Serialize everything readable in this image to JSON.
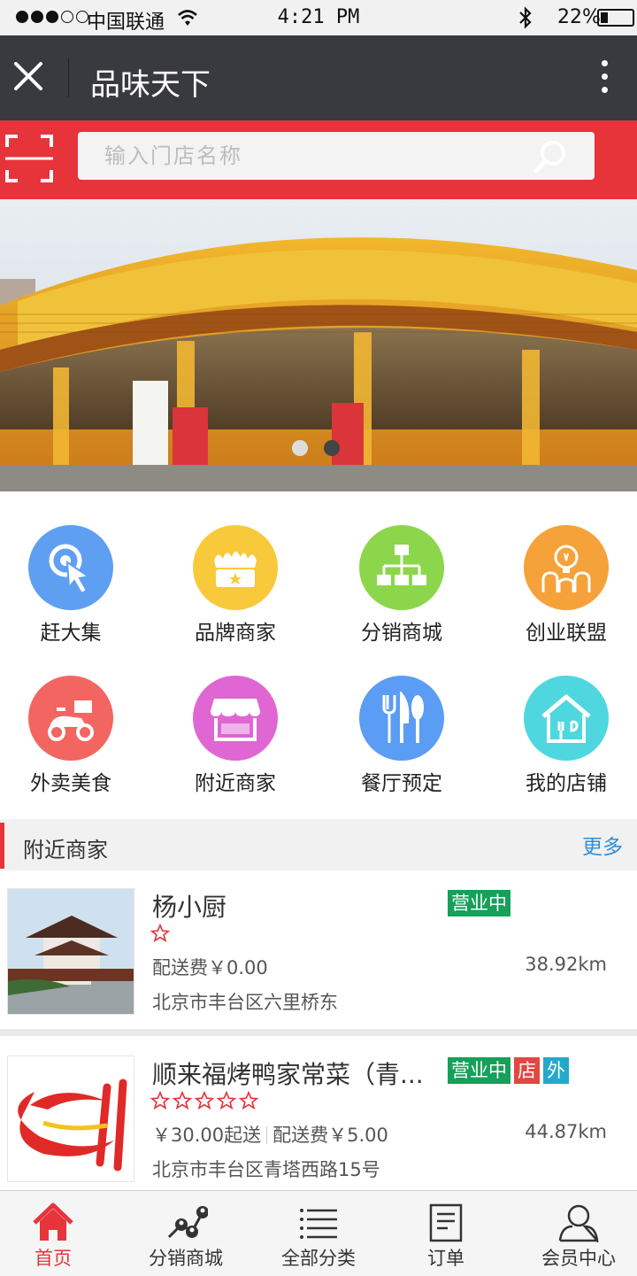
{
  "status_bar": {
    "carrier": "中国联通",
    "time": "4:21 PM",
    "battery": "22%",
    "signal_bars": 3
  },
  "titlebar": {
    "title": "品味天下",
    "close_icon": "close-icon",
    "more_icon": "more-vertical-icon"
  },
  "search": {
    "placeholder": "输入门店名称",
    "scan_icon": "scan-icon",
    "search_icon": "search-icon"
  },
  "banner": {
    "slide_count": 2,
    "active_slide": 1
  },
  "quick_menu": [
    {
      "label": "赶大集",
      "icon": "pointer-click-icon",
      "color": "#5f9ff2"
    },
    {
      "label": "品牌商家",
      "icon": "crown-box-icon",
      "color": "#f9c93c"
    },
    {
      "label": "分销商城",
      "icon": "hierarchy-icon",
      "color": "#8cd64b"
    },
    {
      "label": "创业联盟",
      "icon": "lightbulb-team-icon",
      "color": "#f5a23a"
    },
    {
      "label": "外卖美食",
      "icon": "scooter-icon",
      "color": "#f36561"
    },
    {
      "label": "附近商家",
      "icon": "storefront-icon",
      "color": "#e066d3"
    },
    {
      "label": "餐厅预定",
      "icon": "cutlery-icon",
      "color": "#5b9cf4"
    },
    {
      "label": "我的店铺",
      "icon": "home-shop-icon",
      "color": "#4fd7e0"
    }
  ],
  "nearby": {
    "title": "附近商家",
    "more": "更多",
    "shops": [
      {
        "name": "杨小厨",
        "badges": [
          "营业中"
        ],
        "rating": 0,
        "star_count": 1,
        "min_order": "",
        "delivery_fee": "配送费￥0.00",
        "distance": "38.92km",
        "address": "北京市丰台区六里桥东"
      },
      {
        "name": "顺来福烤鸭家常菜（青...",
        "badges": [
          "营业中",
          "店",
          "外"
        ],
        "rating": 0,
        "star_count": 5,
        "min_order": "￥30.00起送",
        "delivery_fee": "配送费￥5.00",
        "distance": "44.87km",
        "address": "北京市丰台区青塔西路15号"
      }
    ]
  },
  "tabbar": [
    {
      "label": "首页",
      "icon": "home-icon",
      "active": true
    },
    {
      "label": "分销商城",
      "icon": "network-users-icon",
      "active": false
    },
    {
      "label": "全部分类",
      "icon": "list-icon",
      "active": false
    },
    {
      "label": "订单",
      "icon": "order-icon",
      "active": false
    },
    {
      "label": "会员中心",
      "icon": "user-icon",
      "active": false
    }
  ],
  "colors": {
    "brand_red": "#e7343b",
    "titlebar_bg": "#393a3f",
    "status_green": "#16a05a",
    "link_blue": "#2e8fd8"
  }
}
